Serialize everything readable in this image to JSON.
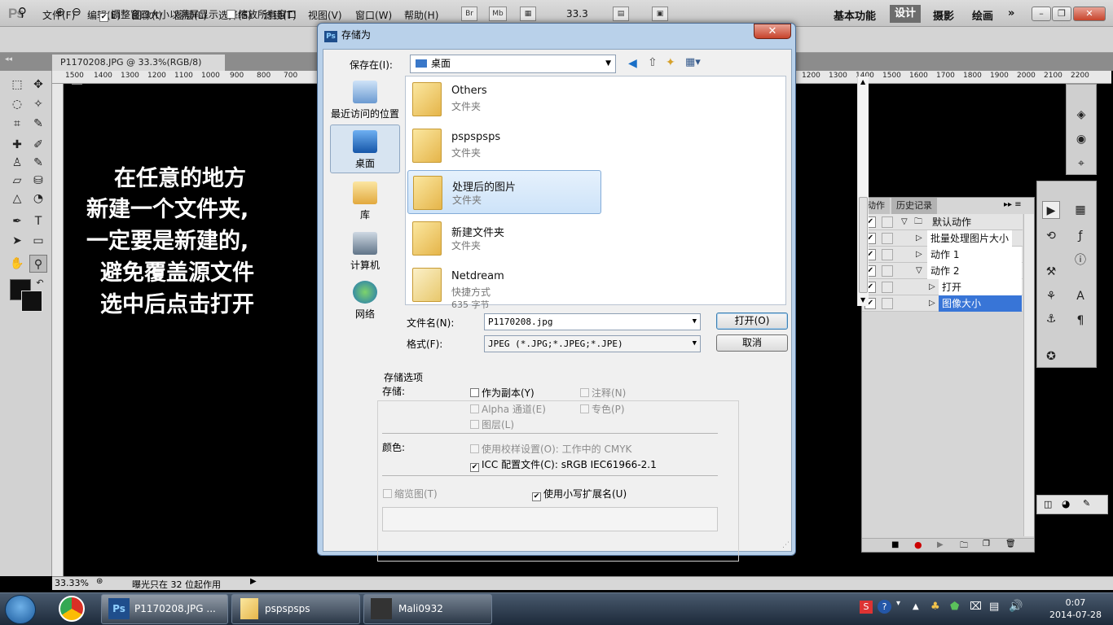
{
  "app": {
    "logo": "Ps",
    "menus": [
      "文件(F)",
      "编辑(E)",
      "图像(I)",
      "图层(L)",
      "选择(S)",
      "滤镜(T)",
      "视图(V)",
      "窗口(W)",
      "帮助(H)"
    ],
    "mini_buttons": [
      "Br",
      "Mb"
    ],
    "zoom_value": "33.3",
    "workspaces": {
      "essentials": "基本功能",
      "design": "设计",
      "photography": "摄影",
      "painting": "绘画",
      "more": "»"
    }
  },
  "options_bar": {
    "resize_window": "调整窗口大小以满屏显示",
    "zoom_all_windows": "缩放所有窗口"
  },
  "document": {
    "tab_title": "P1170208.JPG @ 33.3%(RGB/8) *",
    "ruler_left": [
      "1500",
      "1400",
      "1300",
      "1200",
      "1100",
      "1000",
      "900",
      "800",
      "700"
    ],
    "ruler_right": [
      "1200",
      "1300",
      "1400",
      "1500",
      "1600",
      "1700",
      "1800",
      "1900",
      "2000",
      "2100",
      "2200"
    ],
    "status_zoom": "33.33%",
    "status_text": "曝光只在 32 位起作用"
  },
  "overlay_text": [
    "在任意的地方",
    "新建一个文件夹,",
    "一定要是新建的,",
    "避免覆盖源文件",
    "选中后点击打开"
  ],
  "actions_panel": {
    "tabs": [
      "动作",
      "历史记录"
    ],
    "rows": [
      {
        "label": "默认动作",
        "checked": "✔"
      },
      {
        "label": "批量处理图片大小",
        "checked": "✔"
      },
      {
        "label": "动作 1",
        "checked": "✔"
      },
      {
        "label": "动作 2",
        "checked": "✔"
      },
      {
        "label": "打开",
        "checked": "✔"
      },
      {
        "label": "图像大小",
        "checked": "✔"
      }
    ]
  },
  "dialog": {
    "title": "存储为",
    "close": "✕",
    "save_in_label": "保存在(I):",
    "save_in_value": "桌面",
    "places": [
      "最近访问的位置",
      "桌面",
      "库",
      "计算机",
      "网络"
    ],
    "files": [
      {
        "name": "Others",
        "type": "文件夹"
      },
      {
        "name": "pspspsps",
        "type": "文件夹"
      },
      {
        "name": "处理后的图片",
        "type": "文件夹"
      },
      {
        "name": "新建文件夹",
        "type": "文件夹"
      },
      {
        "name": "Netdream",
        "type": "快捷方式",
        "size": "635 字节"
      }
    ],
    "filename_label": "文件名(N):",
    "filename_value": "P1170208.jpg",
    "format_label": "格式(F):",
    "format_value": "JPEG (*.JPG;*.JPEG;*.JPE)",
    "open_button": "打开(O)",
    "cancel_button": "取消",
    "save_options_title": "存储选项",
    "save_label": "存储:",
    "as_copy": "作为副本(Y)",
    "annotations": "注释(N)",
    "alpha": "Alpha 通道(E)",
    "spot": "专色(P)",
    "layers": "图层(L)",
    "color_label": "颜色:",
    "use_proof": "使用校样设置(O): 工作中的 CMYK",
    "icc": "ICC 配置文件(C): sRGB IEC61966-2.1",
    "thumbnail": "缩览图(T)",
    "lowercase_ext": "使用小写扩展名(U)"
  },
  "taskbar": {
    "items": [
      "P1170208.JPG ...",
      "pspspsps",
      "Mali0932"
    ],
    "time": "0:07",
    "date": "2014-07-28"
  }
}
